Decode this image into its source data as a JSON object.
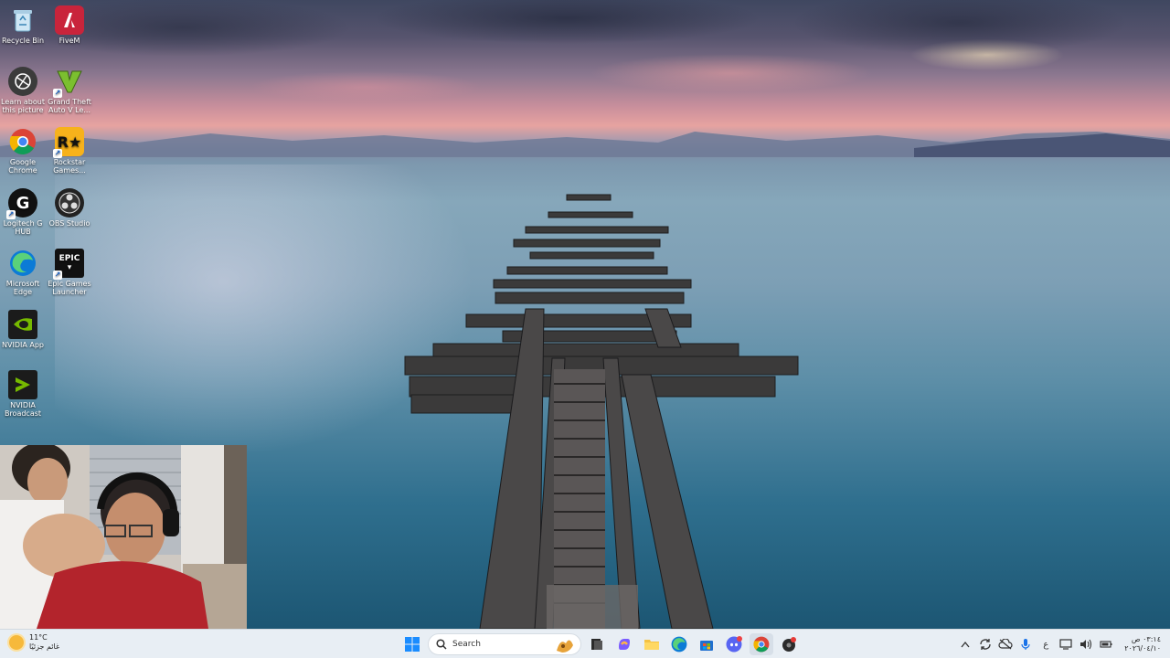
{
  "desktop": {
    "icons": [
      {
        "label": "Recycle Bin"
      },
      {
        "label": "FiveM"
      },
      {
        "label": "Learn about this picture"
      },
      {
        "label": "Grand Theft Auto V Le..."
      },
      {
        "label": "Google Chrome"
      },
      {
        "label": "Rockstar Games..."
      },
      {
        "label": "Logitech G HUB"
      },
      {
        "label": "OBS Studio"
      },
      {
        "label": "Microsoft Edge"
      },
      {
        "label": "Epic Games Launcher"
      },
      {
        "label": "NVIDIA App"
      },
      {
        "label": "NVIDIA Broadcast"
      }
    ]
  },
  "taskbar": {
    "weather": {
      "temp": "11°C",
      "condition": "غائم جزئيًا"
    },
    "search_placeholder": "Search",
    "tray": {
      "lang": "ع"
    },
    "clock": {
      "time": "٠٣:١٤ ص",
      "date": "٢٠٢٦/٠٤/١٠"
    }
  },
  "colors": {
    "taskbar_bg": "#e8eef4",
    "windows_blue": "#1a8cff"
  }
}
